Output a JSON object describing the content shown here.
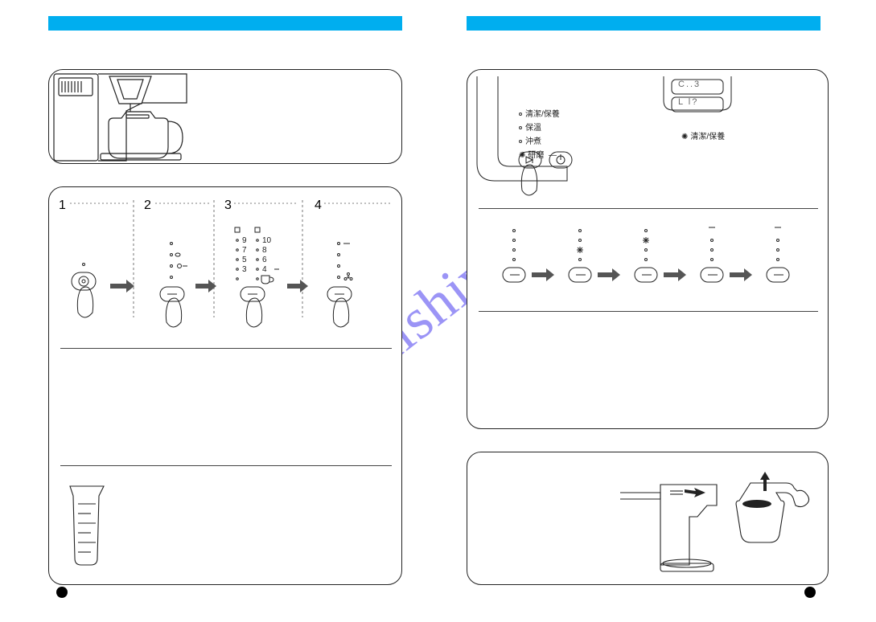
{
  "watermark": "manualshive.com",
  "leftPage": {
    "midPanel": {
      "steps": {
        "s1": "1",
        "s2": "2",
        "s3": "3",
        "s4": "4"
      },
      "numbers": {
        "n9": "9",
        "n10": "10",
        "n7": "7",
        "n8": "8",
        "n5": "5",
        "n6": "6",
        "n3": "3",
        "n4": "4"
      }
    }
  },
  "rightPage": {
    "leds": {
      "l1": "清潔/保養",
      "l2": "保溫",
      "l3": "沖煮",
      "l4": "研磨"
    },
    "rightLabel": "清潔/保養",
    "display1": "C..3",
    "display2": "L l?",
    "dash": "—"
  }
}
